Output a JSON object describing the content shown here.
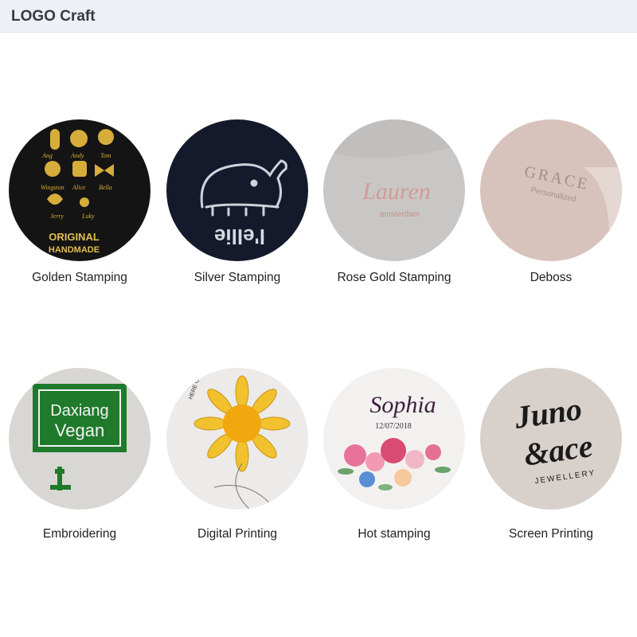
{
  "header": {
    "title": "LOGO Craft"
  },
  "crafts": [
    {
      "label": "Golden Stamping",
      "image_text": [
        "ORIGINAL",
        "HANDMADE"
      ]
    },
    {
      "label": "Silver Stamping",
      "image_text": [
        "l'ellie"
      ]
    },
    {
      "label": "Rose Gold Stamping",
      "image_text": [
        "Lauren",
        "amsterdam"
      ]
    },
    {
      "label": "Deboss",
      "image_text": [
        "GRACE",
        "Personalized"
      ]
    },
    {
      "label": "Embroidering",
      "image_text": [
        "Daxiang",
        "Vegan"
      ]
    },
    {
      "label": "Digital Printing",
      "image_text": [
        "HERE C"
      ]
    },
    {
      "label": "Hot stamping",
      "image_text": [
        "Sophia",
        "12/07/2018"
      ]
    },
    {
      "label": "Screen Printing",
      "image_text": [
        "Juno",
        "&ace",
        "JEWELLERY"
      ]
    }
  ]
}
